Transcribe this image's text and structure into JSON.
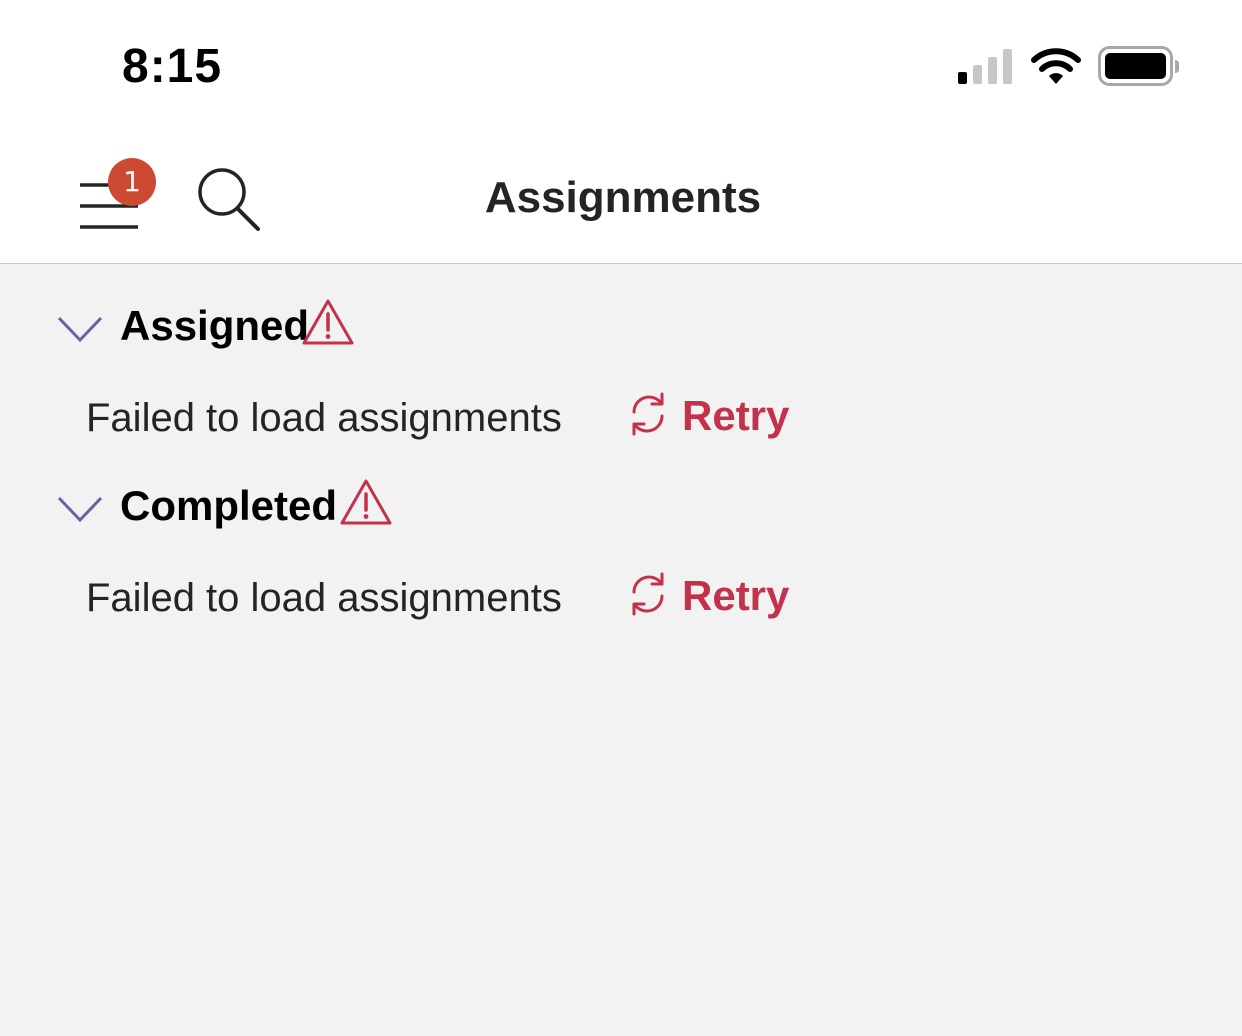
{
  "status_bar": {
    "time": "8:15",
    "icons": [
      "signal-icon",
      "wifi-icon",
      "battery-icon"
    ]
  },
  "nav": {
    "title": "Assignments",
    "menu_badge_count": "1",
    "menu_icon": "hamburger-icon",
    "search_icon": "search-icon"
  },
  "sections": [
    {
      "title": "Assigned",
      "error_message": "Failed to load assignments",
      "retry_label": "Retry"
    },
    {
      "title": "Completed",
      "error_message": "Failed to load assignments",
      "retry_label": "Retry"
    }
  ],
  "colors": {
    "accent_purple": "#6264a7",
    "error_red": "#c4314b",
    "badge_red": "#cc4a31",
    "background": "#f2f2f2"
  }
}
